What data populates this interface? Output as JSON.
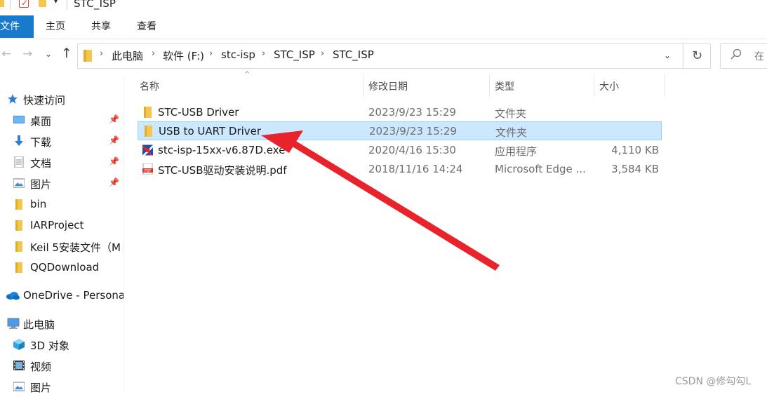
{
  "window": {
    "title": "STC_ISP",
    "quick_access_dropdown": "▾"
  },
  "ribbon": {
    "tabs": [
      {
        "label": "文件"
      },
      {
        "label": "主页"
      },
      {
        "label": "共享"
      },
      {
        "label": "查看"
      }
    ]
  },
  "address": {
    "breadcrumbs": [
      "此电脑",
      "软件 (F:)",
      "stc-isp",
      "STC_ISP",
      "STC_ISP"
    ],
    "separator": "›"
  },
  "search": {
    "placeholder": "在"
  },
  "sidebar": {
    "items": [
      {
        "label": "快速访问",
        "icon": "star-icon",
        "pinned": false
      },
      {
        "label": "桌面",
        "icon": "desktop-icon",
        "pinned": true
      },
      {
        "label": "下载",
        "icon": "download-icon",
        "pinned": true
      },
      {
        "label": "文档",
        "icon": "document-icon",
        "pinned": true
      },
      {
        "label": "图片",
        "icon": "picture-icon",
        "pinned": true
      },
      {
        "label": "bin",
        "icon": "folder-icon",
        "pinned": false
      },
      {
        "label": "IARProject",
        "icon": "folder-icon",
        "pinned": false
      },
      {
        "label": "Keil 5安装文件（M",
        "icon": "folder-icon",
        "pinned": false
      },
      {
        "label": "QQDownload",
        "icon": "folder-icon",
        "pinned": false
      },
      {
        "label": "OneDrive - Persona",
        "icon": "cloud-icon",
        "pinned": false
      },
      {
        "label": "此电脑",
        "icon": "computer-icon",
        "pinned": false
      },
      {
        "label": "3D 对象",
        "icon": "cube-icon",
        "pinned": false
      },
      {
        "label": "视频",
        "icon": "video-icon",
        "pinned": false
      },
      {
        "label": "图片",
        "icon": "picture-icon",
        "pinned": false
      }
    ]
  },
  "columns": {
    "name": "名称",
    "date": "修改日期",
    "type": "类型",
    "size": "大小"
  },
  "files": [
    {
      "name": "STC-USB Driver",
      "date": "2023/9/23 15:29",
      "type": "文件夹",
      "size": "",
      "icon": "folder-icon",
      "selected": false
    },
    {
      "name": "USB to UART Driver",
      "date": "2023/9/23 15:29",
      "type": "文件夹",
      "size": "",
      "icon": "folder-icon",
      "selected": true
    },
    {
      "name": "stc-isp-15xx-v6.87D.exe",
      "date": "2020/4/16 15:30",
      "type": "应用程序",
      "size": "4,110 KB",
      "icon": "exe-icon",
      "selected": false
    },
    {
      "name": "STC-USB驱动安装说明.pdf",
      "date": "2018/11/16 14:24",
      "type": "Microsoft Edge ...",
      "size": "3,584 KB",
      "icon": "pdf-icon",
      "selected": false
    }
  ],
  "watermark": "CSDN @修勾勾L",
  "colors": {
    "file_tab": "#1979ca",
    "selection": "#cce8ff",
    "annotation_arrow": "#e8232b",
    "folder": "#f8d775"
  }
}
